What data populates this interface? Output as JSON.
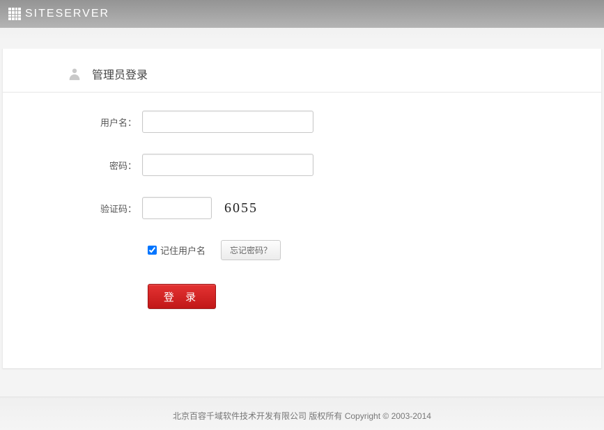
{
  "header": {
    "brand": "SITESERVER"
  },
  "login": {
    "title": "管理员登录",
    "username_label": "用户名：",
    "password_label": "密码：",
    "captcha_label": "验证码：",
    "captcha_value": "6055",
    "remember_label": "记住用户名",
    "remember_checked": true,
    "forgot_button": "忘记密码？",
    "submit_button": "登 录"
  },
  "footer": {
    "copyright": "北京百容千域软件技术开发有限公司 版权所有 Copyright © 2003-2014"
  }
}
